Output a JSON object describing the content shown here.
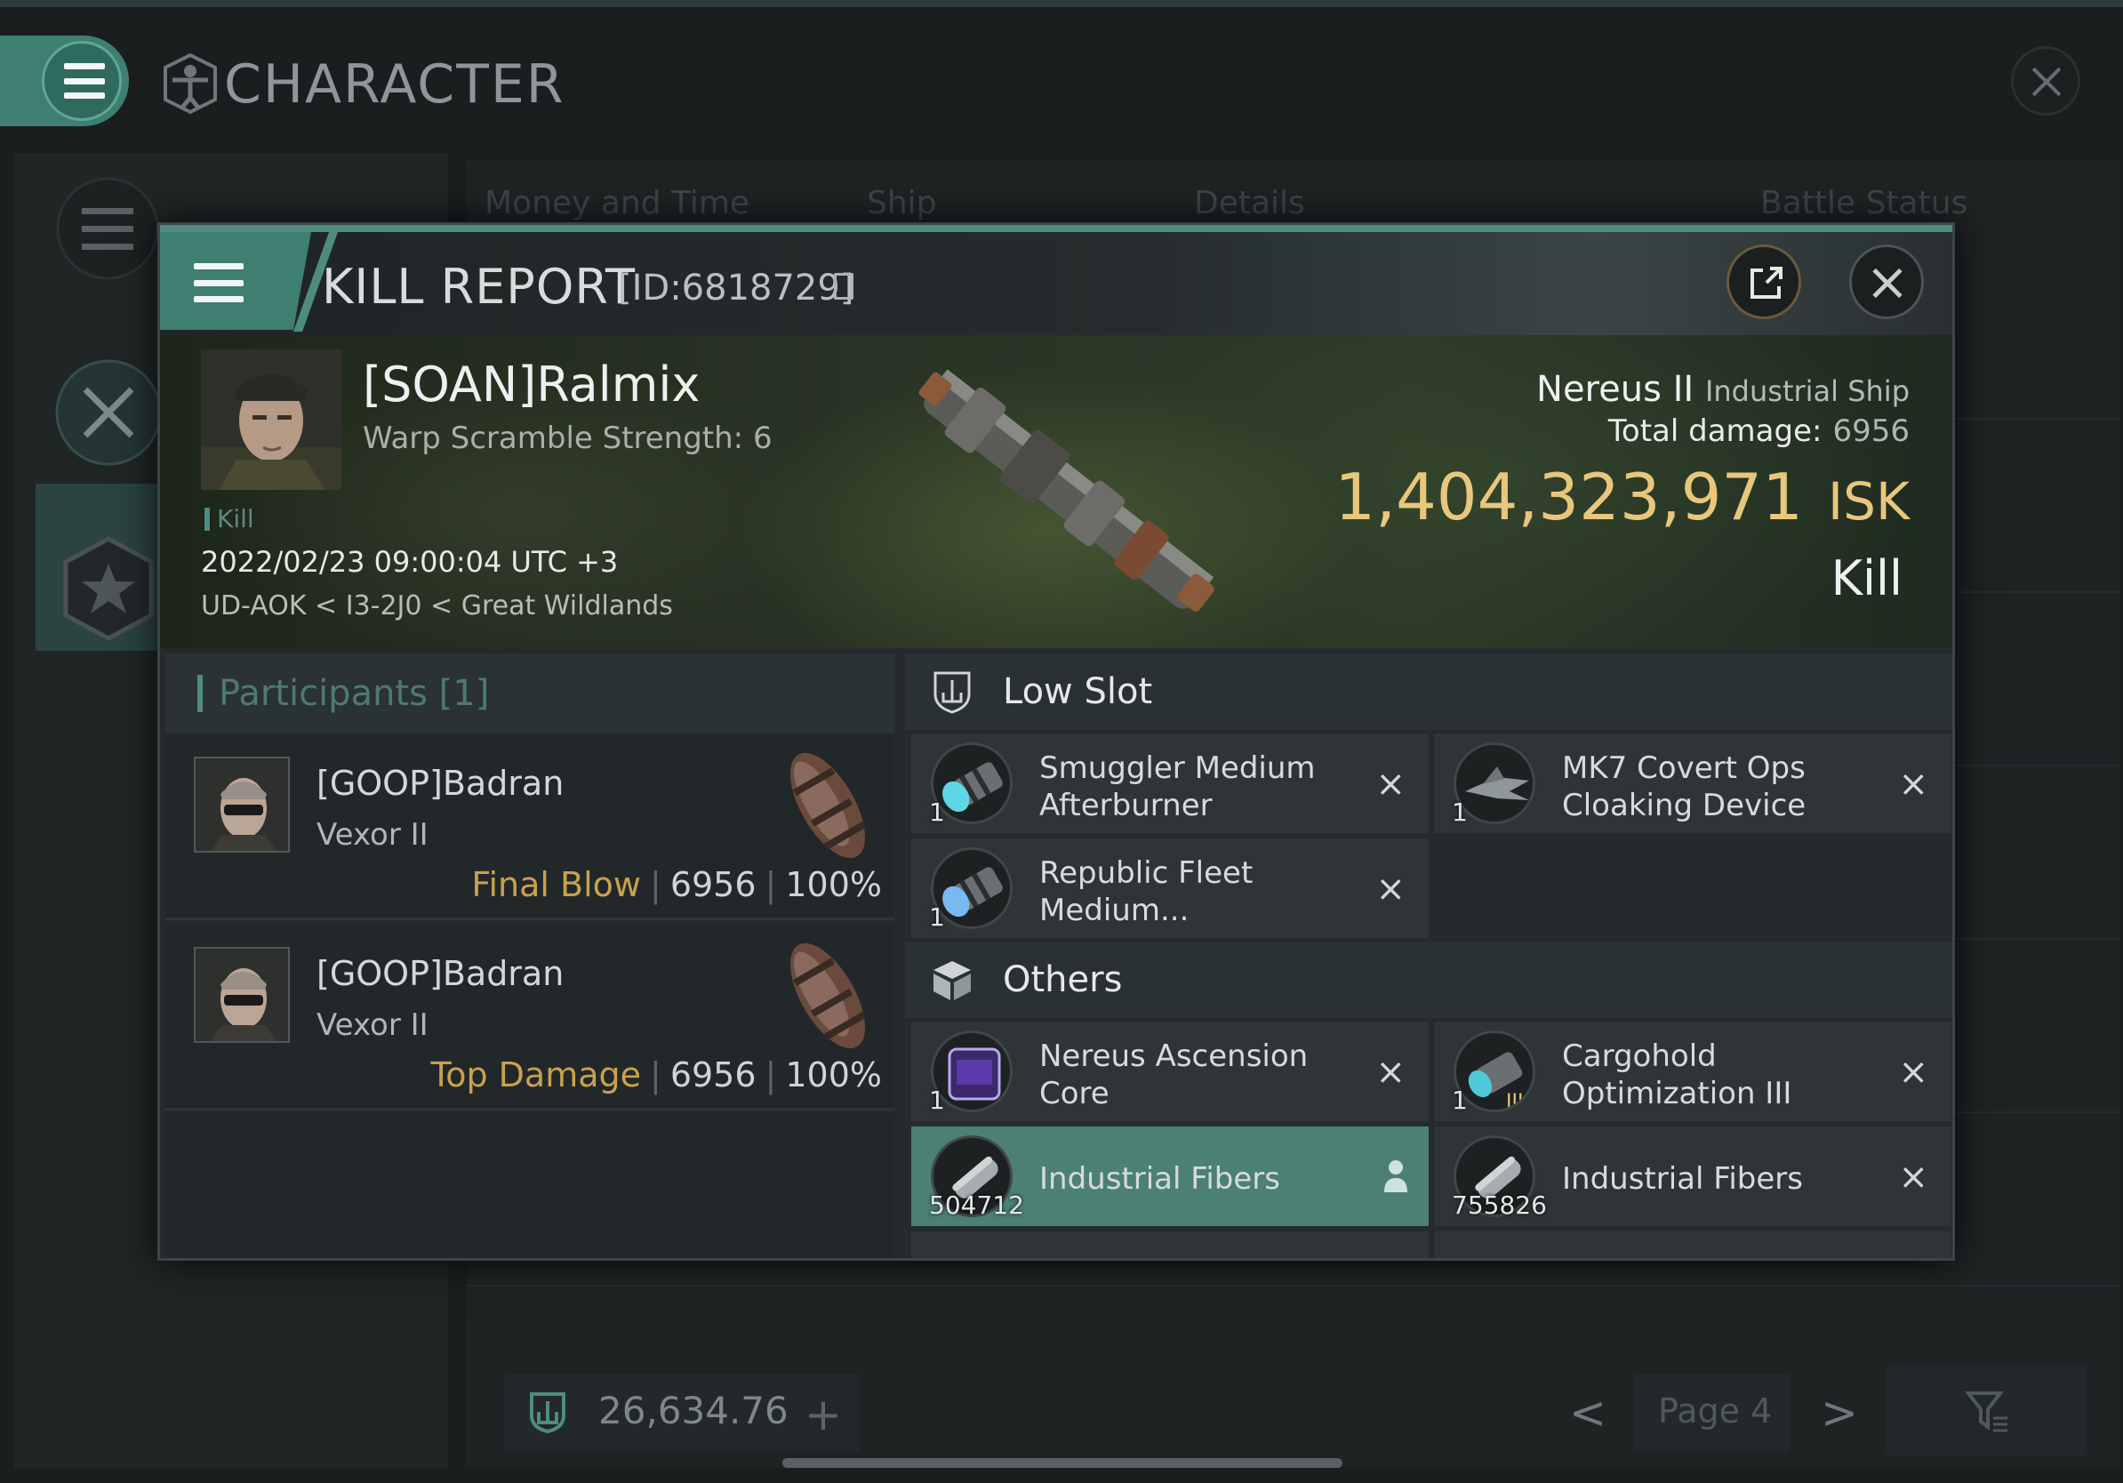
{
  "background_window": {
    "title": "CHARACTER",
    "column_headers": [
      "Money and Time",
      "Ship",
      "Details",
      "Battle Status"
    ],
    "wallet_value": "26,634.76",
    "wallet_add": "+",
    "page_label": "Page 4",
    "prev": "<",
    "next": ">"
  },
  "kill_report": {
    "title": "KILL REPORT",
    "id_label": "[ID:6818729]",
    "victim": {
      "name": "[SOAN]Ralmix",
      "subtitle": "Warp Scramble Strength: 6",
      "tag": "Kill",
      "datetime": "2022/02/23 09:00:04 UTC +3",
      "location": "UD-AOK < I3-2J0 < Great Wildlands"
    },
    "ship": {
      "name": "Nereus II",
      "class": "Industrial Ship",
      "total_damage_label": "Total damage:",
      "total_damage": "6956",
      "isk_value": "1,404,323,971",
      "isk_unit": "ISK",
      "result": "Kill"
    },
    "participants": {
      "title": "Participants [1]",
      "entries": [
        {
          "name": "[GOOP]Badran",
          "ship": "Vexor II",
          "label": "Final Blow",
          "damage": "6956",
          "percent": "100%"
        },
        {
          "name": "[GOOP]Badran",
          "ship": "Vexor II",
          "label": "Top Damage",
          "damage": "6956",
          "percent": "100%"
        }
      ],
      "separator": "|"
    },
    "low_slot": {
      "title": "Low Slot",
      "items": [
        {
          "name": "Smuggler Medium Afterburner",
          "qty": "1",
          "status": "destroyed"
        },
        {
          "name": "MK7 Covert Ops Cloaking Device",
          "qty": "1",
          "status": "destroyed"
        },
        {
          "name": "Republic Fleet Medium...",
          "qty": "1",
          "status": "destroyed"
        }
      ]
    },
    "others": {
      "title": "Others",
      "items": [
        {
          "name": "Nereus Ascension Core",
          "qty": "1",
          "status": "destroyed"
        },
        {
          "name": "Cargohold Optimization III",
          "qty": "1",
          "status": "destroyed",
          "badge": "III"
        },
        {
          "name": "Industrial Fibers",
          "qty": "504712",
          "status": "dropped"
        },
        {
          "name": "Industrial Fibers",
          "qty": "755826",
          "status": "destroyed"
        }
      ]
    },
    "destroyed_mark": "×"
  },
  "colors": {
    "accent_teal": "#4f8c80",
    "isk_gold": "#e8c77c",
    "label_gold": "#c9a14e",
    "highlight_row": "#4c8075"
  }
}
